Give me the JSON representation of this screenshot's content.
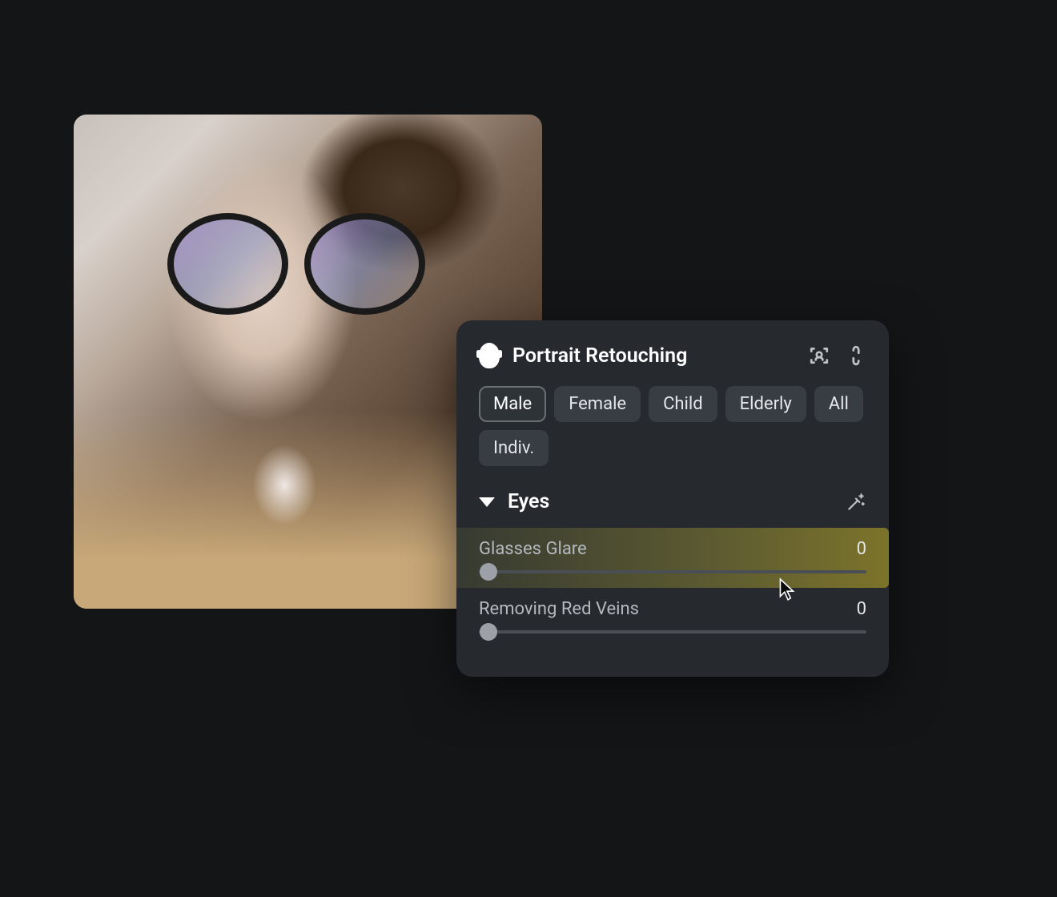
{
  "panel": {
    "title": "Portrait Retouching",
    "chips": [
      "Male",
      "Female",
      "Child",
      "Elderly",
      "All",
      "Indiv."
    ],
    "active_chip_index": 0,
    "section": {
      "title": "Eyes",
      "sliders": [
        {
          "label": "Glasses Glare",
          "value": "0",
          "highlighted": true
        },
        {
          "label": "Removing Red Veins",
          "value": "0",
          "highlighted": false
        }
      ]
    }
  }
}
